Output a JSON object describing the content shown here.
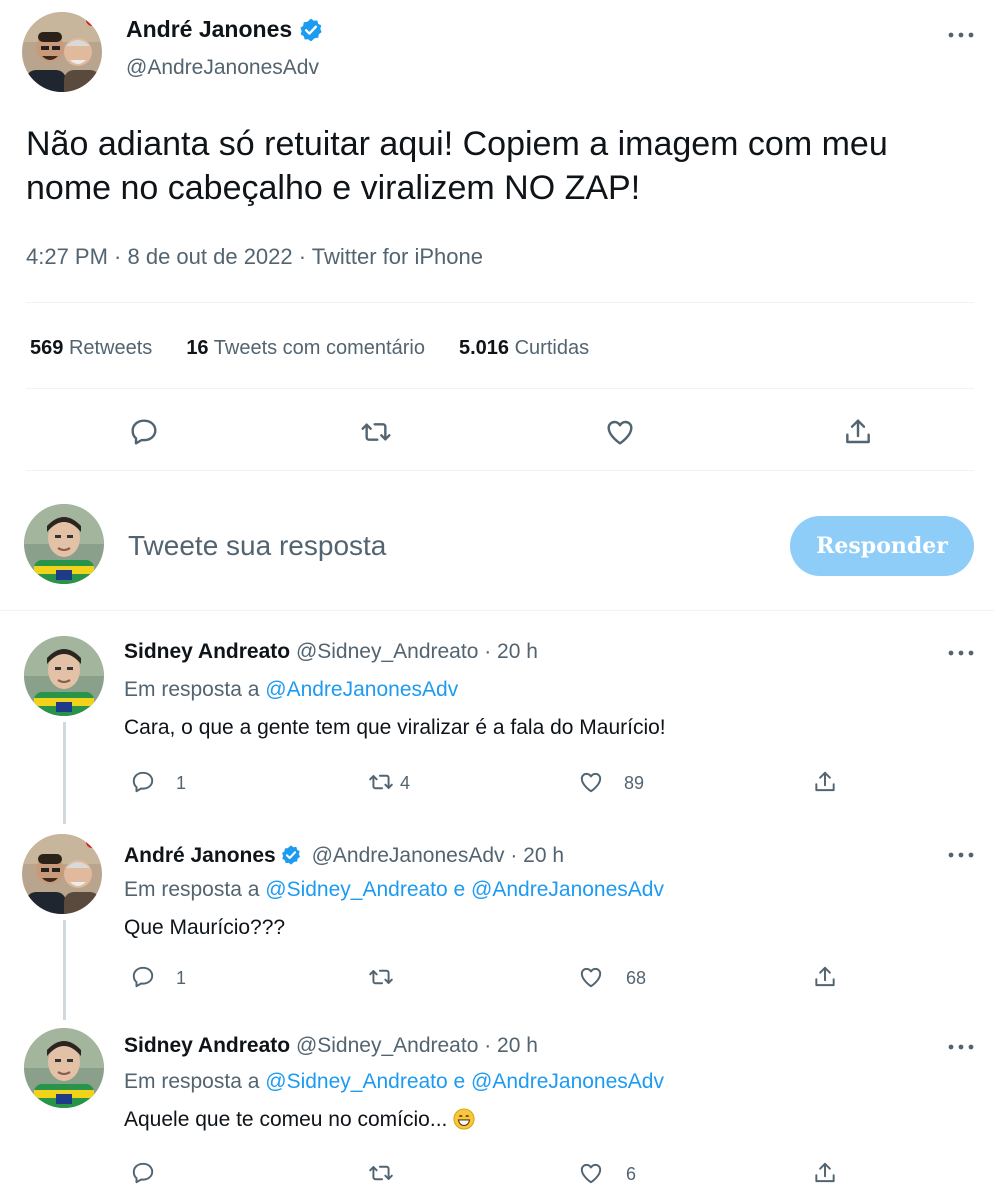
{
  "main_tweet": {
    "author_name": "André Janones",
    "author_handle": "@AndreJanonesAdv",
    "text": "Não adianta só retuitar aqui! Copiem a imagem com meu nome no cabeçalho e viralizem NO ZAP!",
    "meta": "4:27 PM · 8 de out de 2022 · Twitter for iPhone",
    "stats": {
      "retweets_count": "569",
      "retweets_label": "Retweets",
      "quotes_count": "16",
      "quotes_label": "Tweets com comentário",
      "likes_count": "5.016",
      "likes_label": "Curtidas"
    },
    "actions": [
      "reply-icon",
      "retweet-icon",
      "like-icon",
      "share-icon"
    ]
  },
  "compose": {
    "placeholder": "Tweete sua resposta",
    "button_label": "Responder"
  },
  "replies": [
    {
      "name": "Sidney Andreato",
      "handle_time": "@Sidney_Andreato · 20 h",
      "verified": false,
      "reply_prefix": "Em resposta a",
      "reply_to": "@AndreJanonesAdv",
      "text": "Cara, o que a gente tem que viralizar é a fala do Maurício!",
      "reply_count": "1",
      "retweet_count": "4",
      "like_count": "89"
    },
    {
      "name": "André Janones",
      "handle_time": "@AndreJanonesAdv · 20 h",
      "verified": true,
      "reply_prefix": "Em resposta a",
      "reply_to": "@Sidney_Andreato e @AndreJanonesAdv",
      "text": "Que Maurício???",
      "reply_count": "1",
      "retweet_count": "",
      "like_count": "68"
    },
    {
      "name": "Sidney Andreato",
      "handle_time": "@Sidney_Andreato · 20 h",
      "verified": false,
      "reply_prefix": "Em resposta a",
      "reply_to": "@Sidney_Andreato e @AndreJanonesAdv",
      "text": "Aquele que te comeu no comício...",
      "reply_count": "",
      "retweet_count": "",
      "like_count": "6"
    }
  ],
  "colors": {
    "accent": "#1d9bf0",
    "button_disabled": "#8ecdf7",
    "text_secondary": "#536471",
    "divider": "#eff3f4"
  }
}
